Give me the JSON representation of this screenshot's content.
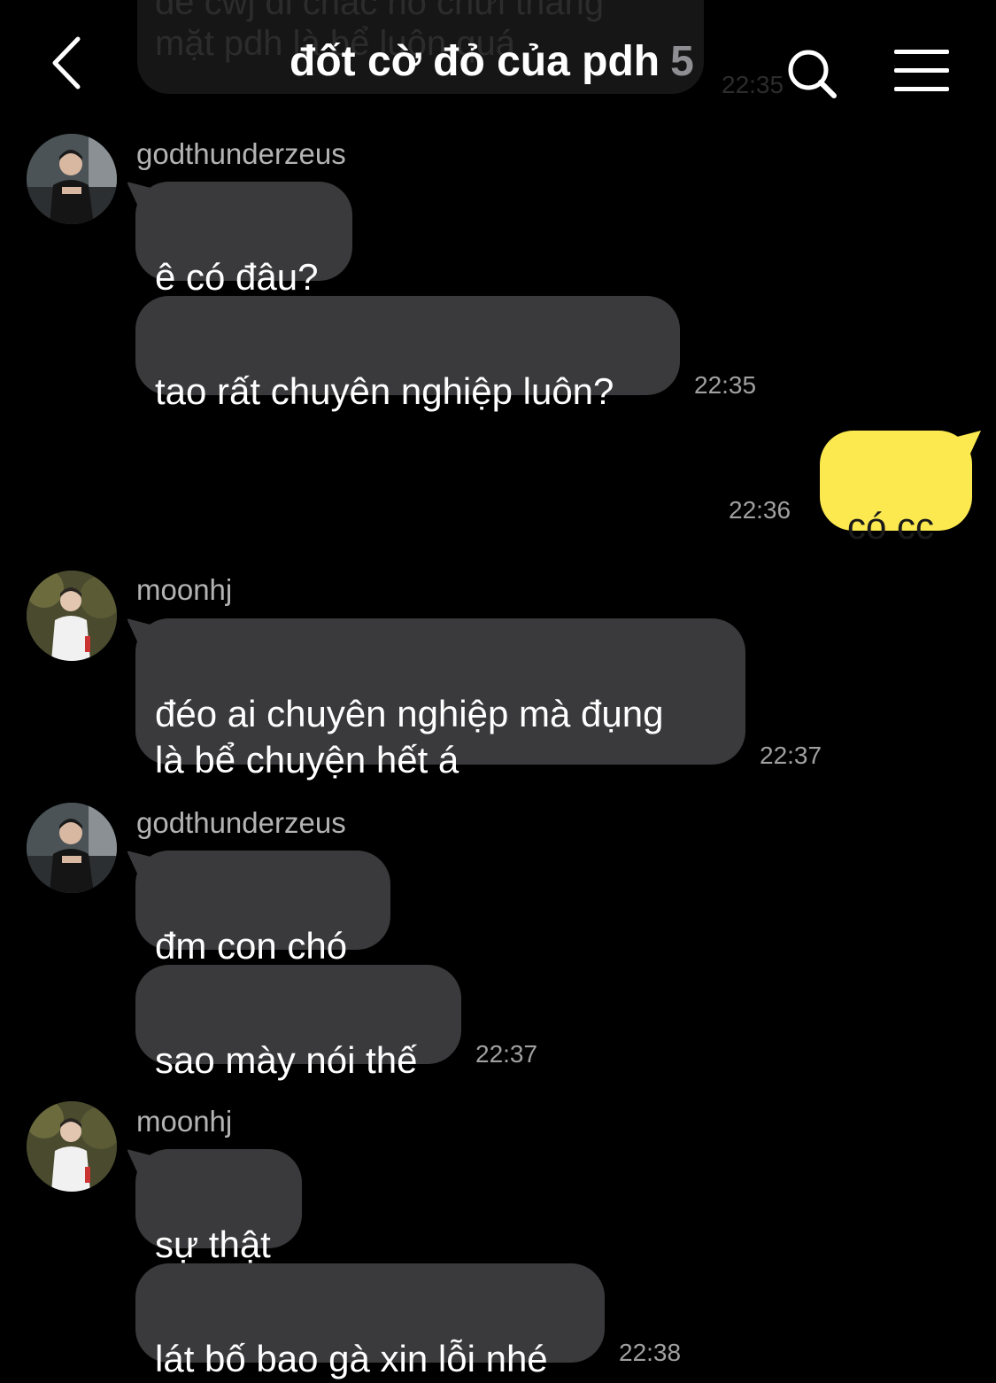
{
  "header": {
    "title": "đốt cờ đỏ của pdh",
    "member_count": "5",
    "back_icon": "chevron-left-icon",
    "search_icon": "search-icon",
    "menu_icon": "hamburger-menu-icon"
  },
  "ghost_message": {
    "text": "để cwj đi chắc nó chửi thẳng\nmặt pdh là bể luôn quá",
    "time": "22:35"
  },
  "messages": [
    {
      "sender": "godthunderzeus",
      "avatar": "avatar-godthunderzeus",
      "text": "ê có đâu?"
    },
    {
      "sender": "",
      "text": "tao rất chuyên nghiệp luôn?",
      "time": "22:35"
    },
    {
      "sender": "me",
      "text": "có cc",
      "time": "22:36"
    },
    {
      "sender": "moonhj",
      "avatar": "avatar-moonhj",
      "text": "đéo ai chuyên nghiệp mà đụng\nlà bể chuyện hết á",
      "time": "22:37"
    },
    {
      "sender": "godthunderzeus",
      "avatar": "avatar-godthunderzeus",
      "text": "đm con chó"
    },
    {
      "sender": "",
      "text": "sao mày nói thế",
      "time": "22:37"
    },
    {
      "sender": "moonhj",
      "avatar": "avatar-moonhj",
      "text": "sự thật"
    },
    {
      "sender": "",
      "text": "lát bố bao gà xin lỗi nhé",
      "time": "22:38"
    }
  ],
  "colors": {
    "background": "#000000",
    "incoming_bubble": "#3a3a3c",
    "outgoing_bubble": "#fce94f",
    "timestamp": "#a0a0a0",
    "sender_name": "#b3b3b3"
  }
}
